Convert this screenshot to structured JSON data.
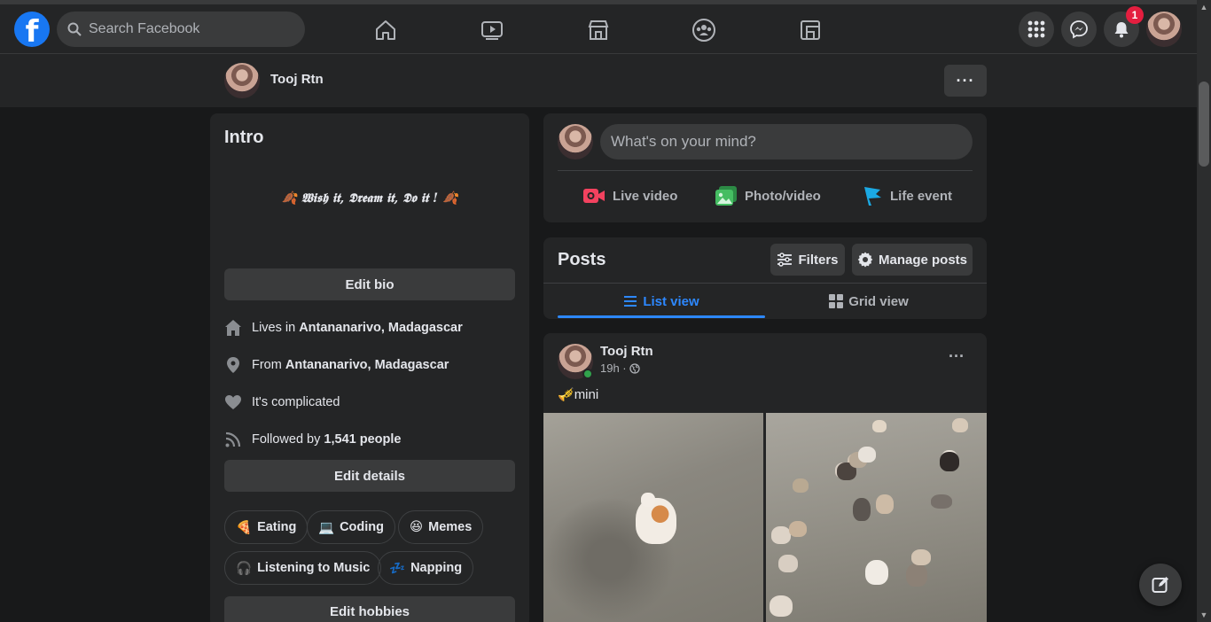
{
  "header": {
    "logo": "f",
    "search_placeholder": "Search Facebook",
    "notification_count": "1",
    "nav_icons": [
      "home-icon",
      "watch-icon",
      "marketplace-icon",
      "groups-icon",
      "gaming-icon"
    ],
    "right_icons": [
      "menu-grid-icon",
      "messenger-icon",
      "bell-icon",
      "account-avatar"
    ]
  },
  "profile": {
    "name": "Tooj Rtn",
    "more_label": "···"
  },
  "intro": {
    "title": "Intro",
    "bio": "🍂 𝖂𝖎𝖘𝖍 𝖎𝖙, 𝕯𝖗𝖊𝖆𝖒 𝖎𝖙, 𝕯𝖔 𝖎𝖙 ! 🍂",
    "edit_bio": "Edit bio",
    "details": [
      {
        "icon": "house-icon",
        "prefix": "Lives in ",
        "value": "Antananarivo, Madagascar"
      },
      {
        "icon": "location-pin-icon",
        "prefix": "From ",
        "value": "Antananarivo, Madagascar"
      },
      {
        "icon": "heart-icon",
        "prefix": "It's complicated",
        "value": ""
      },
      {
        "icon": "rss-icon",
        "prefix": "Followed by ",
        "value": "1,541 people"
      }
    ],
    "edit_details": "Edit details",
    "hobbies": [
      {
        "emoji": "🍕",
        "label": "Eating"
      },
      {
        "emoji": "💻",
        "label": "Coding"
      },
      {
        "emoji": "😆",
        "label": "Memes"
      },
      {
        "emoji": "🎧",
        "label": "Listening to Music"
      },
      {
        "emoji": "💤",
        "label": "Napping"
      }
    ],
    "edit_hobbies": "Edit hobbies"
  },
  "create_post": {
    "placeholder": "What's on your mind?",
    "actions": [
      {
        "icon": "live-video-icon",
        "label": "Live video",
        "color": "#f3425f"
      },
      {
        "icon": "photo-video-icon",
        "label": "Photo/video",
        "color": "#45bd62"
      },
      {
        "icon": "life-event-icon",
        "label": "Life event",
        "color": "#1ba9e3"
      }
    ]
  },
  "posts": {
    "title": "Posts",
    "filters": "Filters",
    "manage": "Manage posts",
    "list_view": "List view",
    "grid_view": "Grid view",
    "active_tab": "List view",
    "accent": "#2d88ff"
  },
  "post": {
    "author": "Tooj Rtn",
    "time": "19h ·",
    "privacy_icon": "globe-icon",
    "text_emoji": "🎺",
    "text": "mini",
    "more": "···",
    "photos": [
      "kitten-photo",
      "kittens-group-photo"
    ]
  },
  "colors": {
    "background": "#18191a",
    "card": "#242526",
    "button": "#3a3b3c",
    "brand": "#1877f2",
    "badge": "#e41e3f"
  }
}
